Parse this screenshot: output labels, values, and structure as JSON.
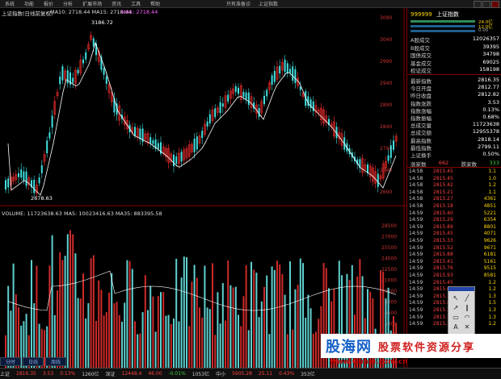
{
  "menubar": {
    "items": [
      "系统",
      "功能",
      "报价",
      "分析",
      "扩展市场",
      "资讯",
      "工具",
      "帮助"
    ],
    "center": [
      "只有准备诊",
      "上证指数"
    ]
  },
  "price_chart": {
    "legend_title": "上证指数(日线前复权)",
    "ma_label": "MA10: 2718.44  MA15: 2718.44",
    "ma_right": "MA5: 2718.44",
    "high_label": "3186.72",
    "low_label": "2678.63",
    "axis_labels": [
      "3090",
      "3040",
      "2990",
      "2940",
      "2890",
      "2840",
      "2790",
      "2740",
      "2690"
    ]
  },
  "volume_chart": {
    "legend": "VOLUME: 11723638.63  MA5: 10023416.63  MA35: 883395.58",
    "axis_labels": [
      "28500",
      "27000",
      "25500",
      "24000",
      "22500",
      "21000",
      "19500",
      "18000",
      "16500",
      "15000",
      "13500",
      "12000"
    ]
  },
  "panel": {
    "code": "999999",
    "name": "上证指数",
    "top_levels": [
      {
        "label": "24.0亿",
        "color": "#ffd700"
      },
      {
        "label": "12.0亿",
        "color": "#ffd700"
      },
      {
        "label": "0.00",
        "color": "#aaa"
      }
    ],
    "stats": [
      {
        "label": "A股成交",
        "value": "12026357"
      },
      {
        "label": "B股成交",
        "value": "39395"
      },
      {
        "label": "国债成交",
        "value": "34798"
      },
      {
        "label": "基金成交",
        "value": "69025"
      },
      {
        "label": "权证成交",
        "value": "158198"
      }
    ],
    "quotes": [
      {
        "label": "最新指数",
        "value": "2816.35",
        "color": "red"
      },
      {
        "label": "今日开盘",
        "value": "2812.77",
        "color": "red"
      },
      {
        "label": "昨日收盘",
        "value": "2812.82",
        "color": "white"
      },
      {
        "label": "指数涨跌",
        "value": "3.53",
        "color": "red"
      },
      {
        "label": "指数涨幅",
        "value": "0.13%",
        "color": "red"
      },
      {
        "label": "指数振幅",
        "value": "0.68%",
        "color": "white"
      },
      {
        "label": "总成交量",
        "value": "11723638",
        "color": "white"
      },
      {
        "label": "总成交额",
        "value": "12955378",
        "color": "white"
      },
      {
        "label": "最高指数",
        "value": "2818.14",
        "color": "red"
      },
      {
        "label": "最低指数",
        "value": "2799.11",
        "color": "green"
      },
      {
        "label": "上证换手",
        "value": "0.50%",
        "color": "white"
      }
    ],
    "breadth": {
      "up_label": "涨家数",
      "up": "662",
      "down_label": "跌家数",
      "down": "333"
    },
    "trades": [
      {
        "time": "14:58",
        "price": "2815.45",
        "vol": "1.1"
      },
      {
        "time": "14:58",
        "price": "2815.45",
        "vol": "1.0"
      },
      {
        "time": "14:58",
        "price": "2815.42",
        "vol": "1.2"
      },
      {
        "time": "14:58",
        "price": "2815.21",
        "vol": "1.1"
      },
      {
        "time": "14:58",
        "price": "2815.27",
        "vol": "4361"
      },
      {
        "time": "14:58",
        "price": "2815.18",
        "vol": "4851"
      },
      {
        "time": "14:59",
        "price": "2815.40",
        "vol": "5221"
      },
      {
        "time": "14:59",
        "price": "2815.29",
        "vol": "6354"
      },
      {
        "time": "14:59",
        "price": "2815.89",
        "vol": "8801"
      },
      {
        "time": "14:59",
        "price": "2815.45",
        "vol": "4071"
      },
      {
        "time": "14:59",
        "price": "2815.33",
        "vol": "9626"
      },
      {
        "time": "14:59",
        "price": "2815.52",
        "vol": "9671"
      },
      {
        "time": "14:59",
        "price": "2815.88",
        "vol": "6181"
      },
      {
        "time": "14:59",
        "price": "2815.41",
        "vol": "5161"
      },
      {
        "time": "14:59",
        "price": "2815.76",
        "vol": "9515"
      },
      {
        "time": "14:59",
        "price": "2815.93",
        "vol": "8581"
      },
      {
        "time": "14:59",
        "price": "2815.45",
        "vol": "1.2"
      },
      {
        "time": "14:59",
        "price": "2815.63",
        "vol": "1.2"
      },
      {
        "time": "14:59",
        "price": "2815.77",
        "vol": "1.3"
      },
      {
        "time": "14:59",
        "price": "2815.80",
        "vol": "1.5"
      },
      {
        "time": "14:59",
        "price": "2815.22",
        "vol": "1.3"
      },
      {
        "time": "14:59",
        "price": "2815.20",
        "vol": "1.3"
      },
      {
        "time": "14:59",
        "price": "2815.35",
        "vol": "1.2"
      }
    ]
  },
  "tabs": [
    "分时",
    "日线",
    "周线"
  ],
  "bottombar": [
    "上证",
    "2816.35",
    "3.53",
    "0.13%",
    "1260亿",
    "深证",
    "12448.4",
    "46.00",
    "-0.01%",
    "1053亿",
    "中小",
    "5905.28",
    "25.11",
    "0.43%",
    "353亿"
  ],
  "watermark": {
    "brand": "股海网",
    "text": "股票软件资源分享",
    "url": "www.Guhai.com.cn"
  }
}
